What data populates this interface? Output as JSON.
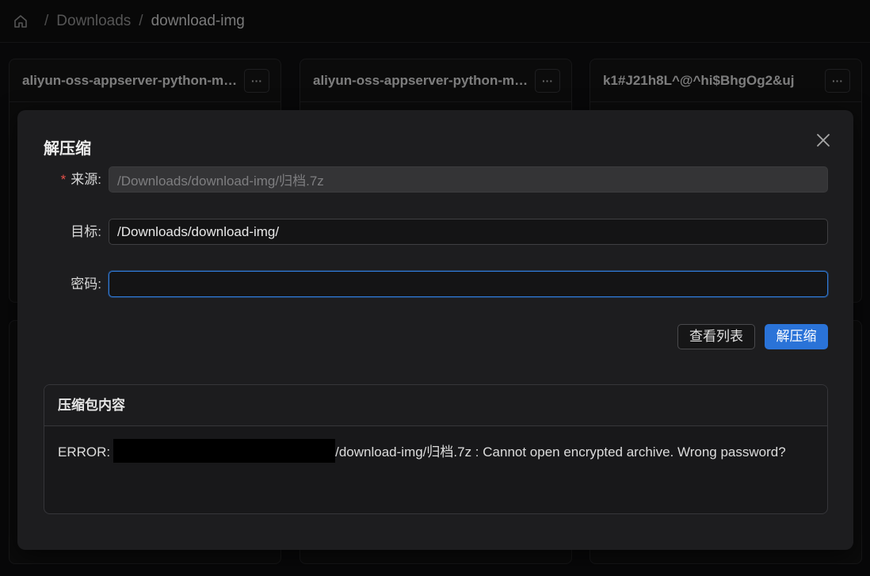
{
  "breadcrumb": {
    "items": [
      "Downloads",
      "download-img"
    ],
    "separator": "/"
  },
  "cards": [
    {
      "title": "aliyun-oss-appserver-python-master.zip",
      "menu": "···"
    },
    {
      "title": "aliyun-oss-appserver-python-master.zip",
      "menu": "···"
    },
    {
      "title": "k1#J21h8L^@^hi$BhgOg2&uj",
      "menu": "···"
    }
  ],
  "modal": {
    "title": "解压缩",
    "fields": {
      "source": {
        "label": "来源",
        "required_mark": "*",
        "value": "/Downloads/download-img/归档.7z"
      },
      "target": {
        "label": "目标",
        "value": "/Downloads/download-img/"
      },
      "password": {
        "label": "密码",
        "value": "",
        "placeholder": ""
      }
    },
    "label_colon": ":",
    "buttons": {
      "list": "查看列表",
      "extract": "解压缩"
    },
    "result": {
      "title": "压缩包内容",
      "error_prefix": "ERROR:",
      "error_rest": "/download-img/归档.7z : Cannot open encrypted archive. Wrong password?"
    }
  },
  "colors": {
    "accent": "#2a73d8",
    "required": "#e4504a",
    "background": "#101011"
  }
}
